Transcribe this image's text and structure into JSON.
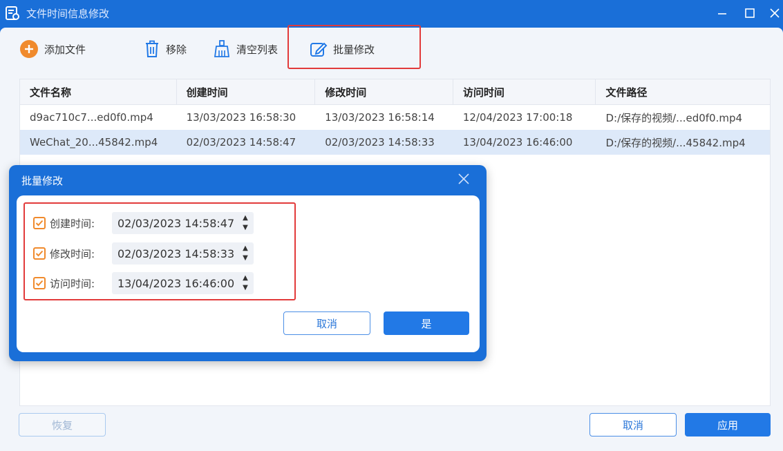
{
  "window": {
    "title": "文件时间信息修改",
    "minimize_icon": "minimize-icon",
    "maximize_icon": "maximize-icon",
    "close_icon": "close-icon"
  },
  "toolbar": {
    "add_label": "添加文件",
    "remove_label": "移除",
    "clear_label": "清空列表",
    "batch_label": "批量修改",
    "accent": "#f08a2c"
  },
  "table": {
    "columns": [
      "文件名称",
      "创建时间",
      "修改时间",
      "访问时间",
      "文件路径"
    ],
    "rows": [
      [
        "d9ac710c7...ed0f0.mp4",
        "13/03/2023 16:58:30",
        "13/03/2023 16:58:14",
        "12/04/2023 17:00:18",
        "D:/保存的视频/...ed0f0.mp4"
      ],
      [
        "WeChat_20...45842.mp4",
        "02/03/2023 14:58:47",
        "02/03/2023 14:58:33",
        "13/04/2023 16:46:00",
        "D:/保存的视频/...45842.mp4"
      ]
    ],
    "selected_row": 1
  },
  "footer": {
    "restore_label": "恢复",
    "cancel_label": "取消",
    "apply_label": "应用"
  },
  "dialog": {
    "title": "批量修改",
    "fields": [
      {
        "label": "创建时间:",
        "value": "02/03/2023 14:58:47",
        "checked": true
      },
      {
        "label": "修改时间:",
        "value": "02/03/2023 14:58:33",
        "checked": true
      },
      {
        "label": "访问时间:",
        "value": "13/04/2023 16:46:00",
        "checked": true
      }
    ],
    "cancel_label": "取消",
    "confirm_label": "是"
  },
  "colors": {
    "brand_blue": "#1a6fd8",
    "primary_button": "#2279e6",
    "highlight_red": "#e23a3a",
    "checkbox_orange": "#f08a2c",
    "selected_row": "#dde9f9"
  }
}
